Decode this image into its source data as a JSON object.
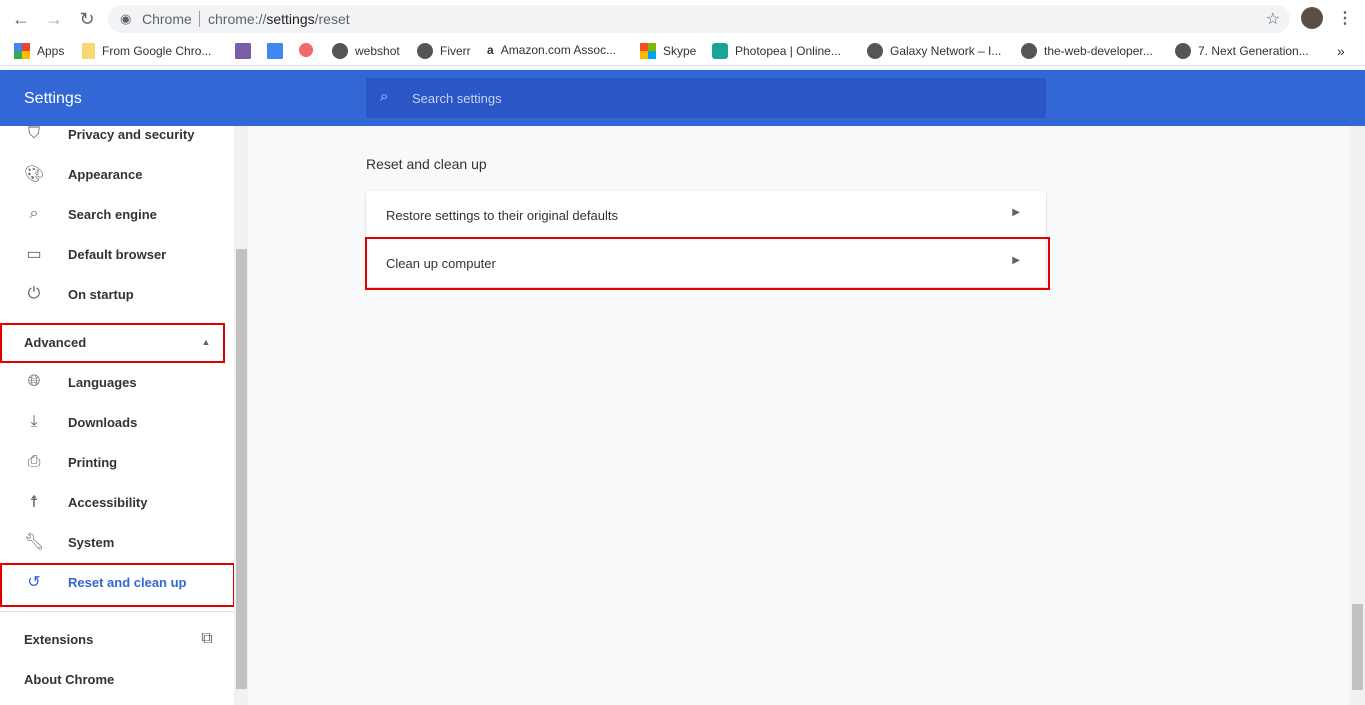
{
  "browser": {
    "site_label": "Chrome",
    "url_prefix": "chrome://",
    "url_host": "settings",
    "url_path": "/reset",
    "bookmarks": [
      "Apps",
      "From Google Chro...",
      "",
      "",
      "",
      "webshot",
      "Fiverr",
      "Amazon.com Assoc...",
      "Skype",
      "Photopea | Online...",
      "Galaxy Network – I...",
      "the-web-developer...",
      "7. Next Generation..."
    ],
    "overflow": "»"
  },
  "header": {
    "title": "Settings",
    "search_placeholder": "Search settings"
  },
  "sidebar": {
    "items": [
      {
        "label": "Privacy and security",
        "icon": "shield-icon"
      },
      {
        "label": "Appearance",
        "icon": "palette-icon"
      },
      {
        "label": "Search engine",
        "icon": "search-icon"
      },
      {
        "label": "Default browser",
        "icon": "browser-icon"
      },
      {
        "label": "On startup",
        "icon": "power-icon"
      },
      {
        "label": "Advanced",
        "icon": "chevron-up-icon"
      },
      {
        "label": "Languages",
        "icon": "globe-icon"
      },
      {
        "label": "Downloads",
        "icon": "download-icon"
      },
      {
        "label": "Printing",
        "icon": "printer-icon"
      },
      {
        "label": "Accessibility",
        "icon": "accessibility-icon"
      },
      {
        "label": "System",
        "icon": "wrench-icon"
      },
      {
        "label": "Reset and clean up",
        "icon": "history-icon",
        "active": true
      },
      {
        "label": "Extensions",
        "icon": "open-in-new-icon"
      },
      {
        "label": "About Chrome"
      }
    ]
  },
  "main": {
    "section_title": "Reset and clean up",
    "rows": [
      {
        "label": "Restore settings to their original defaults"
      },
      {
        "label": "Clean up computer"
      }
    ]
  },
  "colors": {
    "accent": "#3367d6",
    "highlight": "#e00000"
  }
}
